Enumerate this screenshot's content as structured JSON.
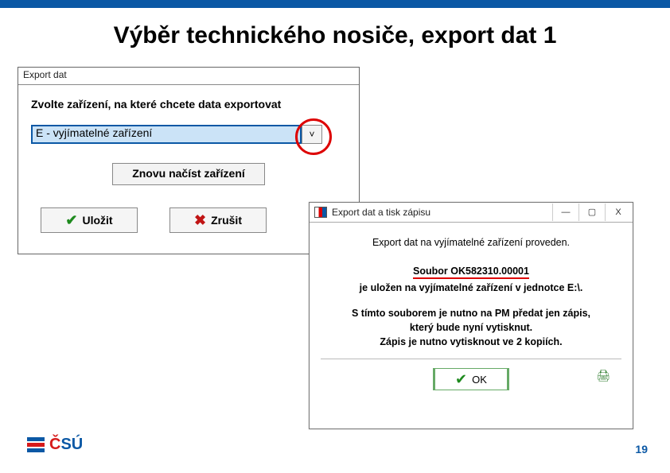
{
  "slide_title": "Výběr technického nosiče, export dat  1",
  "dlg1": {
    "title": "Export dat",
    "prompt": "Zvolte zařízení, na které chcete data exportovat",
    "combo_value": "E - vyjímatelné zařízení",
    "reload_label": "Znovu načíst zařízení",
    "save_label": "Uložit",
    "cancel_label": "Zrušit"
  },
  "dlg2": {
    "title": "Export dat a tisk zápisu",
    "line1": "Export dat na vyjímatelné zařízení proveden.",
    "file_label": "Soubor OK582310.00001",
    "line2": "je uložen na vyjímatelné zařízení v jednotce E:\\.",
    "line3": "S tímto souborem je nutno na PM předat jen zápis,",
    "line4": "který bude nyní vytisknut.",
    "line5": "Zápis je nutno vytisknout ve 2 kopiích.",
    "ok_label": "OK"
  },
  "window_controls": {
    "minimize": "—",
    "maximize": "▢",
    "close": "X"
  },
  "footer": {
    "logo_c": "Č",
    "logo_rest": "SÚ"
  },
  "page_number": "19"
}
